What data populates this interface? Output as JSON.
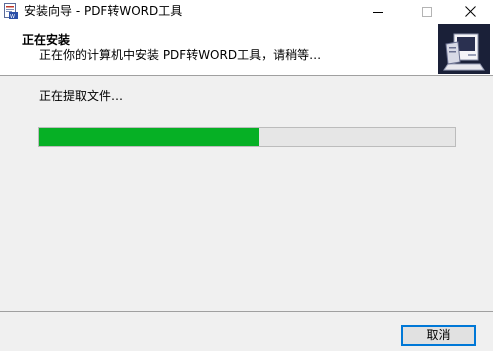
{
  "window": {
    "title": "安装向导 - PDF转WORD工具",
    "icons": {
      "app": "installer-app-icon",
      "minimize": "minimize-icon",
      "maximize": "maximize-icon",
      "close": "close-icon"
    }
  },
  "header": {
    "title": "正在安装",
    "subtitle": "正在你的计算机中安装 PDF转WORD工具，请稍等…",
    "logo_icon": "computer-install-logo"
  },
  "main": {
    "status": "正在提取文件…",
    "progress_fraction": 0.53,
    "progress_color": "#06b025"
  },
  "footer": {
    "cancel_label": "取消"
  },
  "colors": {
    "accent": "#0078d7",
    "header_bg": "#ffffff",
    "body_bg": "#f0f0f0"
  }
}
